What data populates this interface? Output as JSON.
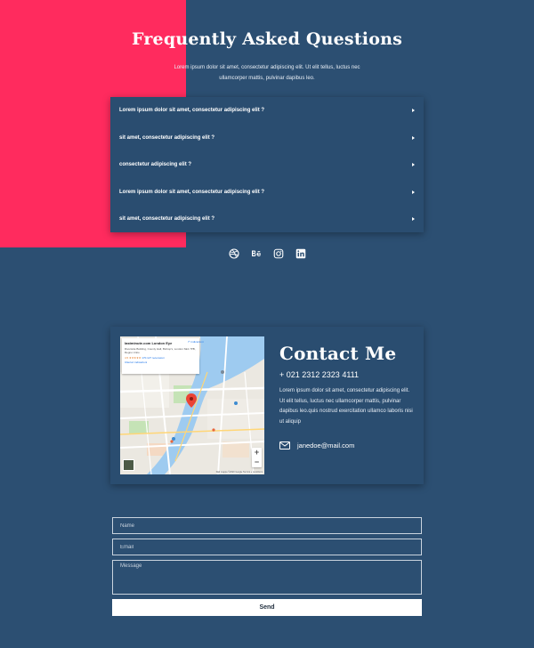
{
  "faq": {
    "title": "Frequently Asked Questions",
    "intro": "Lorem ipsum dolor sit amet, consectetur adipiscing elit. Ut elit tellus, luctus nec ullamcorper mattis, pulvinar dapibus leo.",
    "items": [
      {
        "question": "Lorem ipsum dolor sit amet, consectetur adipiscing elit ?"
      },
      {
        "question": "sit amet, consectetur adipiscing elit ?"
      },
      {
        "question": "consectetur adipiscing elit ?"
      },
      {
        "question": "Lorem ipsum dolor sit amet, consectetur adipiscing elit ?"
      },
      {
        "question": "sit amet, consectetur adipiscing elit ?"
      }
    ]
  },
  "social": {
    "icons": [
      "dribbble-icon",
      "behance-icon",
      "instagram-icon",
      "linkedin-icon"
    ]
  },
  "contact": {
    "title": "Contact Me",
    "phone": "+ 021 2312 2323 4111",
    "description": "Lorem ipsum dolor sit amet, consectetur adipiscing elit. Ut elit tellus, luctus nec ullamcorper mattis, pulvinar dapibus leo.quis nostrud exercitation ullamco laboris nisi ut aliquip",
    "email": "janedoe@mail.com",
    "map": {
      "place_title": "lastminute.com London Eye",
      "place_address": "Riverside Building, County Hall, Bishop's, London SE1 7PB, Regno Unito",
      "rating": "4.5 ★★★★★",
      "reviews": "170.127 recensioni",
      "larger_map_link": "Ulteriori indicazioni",
      "directions": "Indicazioni",
      "footer": "Dati mappa ©2020 Google  Termini e condizioni"
    }
  },
  "form": {
    "name_placeholder": "Name",
    "email_placeholder": "Email",
    "message_placeholder": "Message",
    "send_label": "Send"
  },
  "colors": {
    "background": "#2c4f72",
    "accent": "#ff2b5e",
    "card": "#2a4d70",
    "text": "#ffffff"
  }
}
